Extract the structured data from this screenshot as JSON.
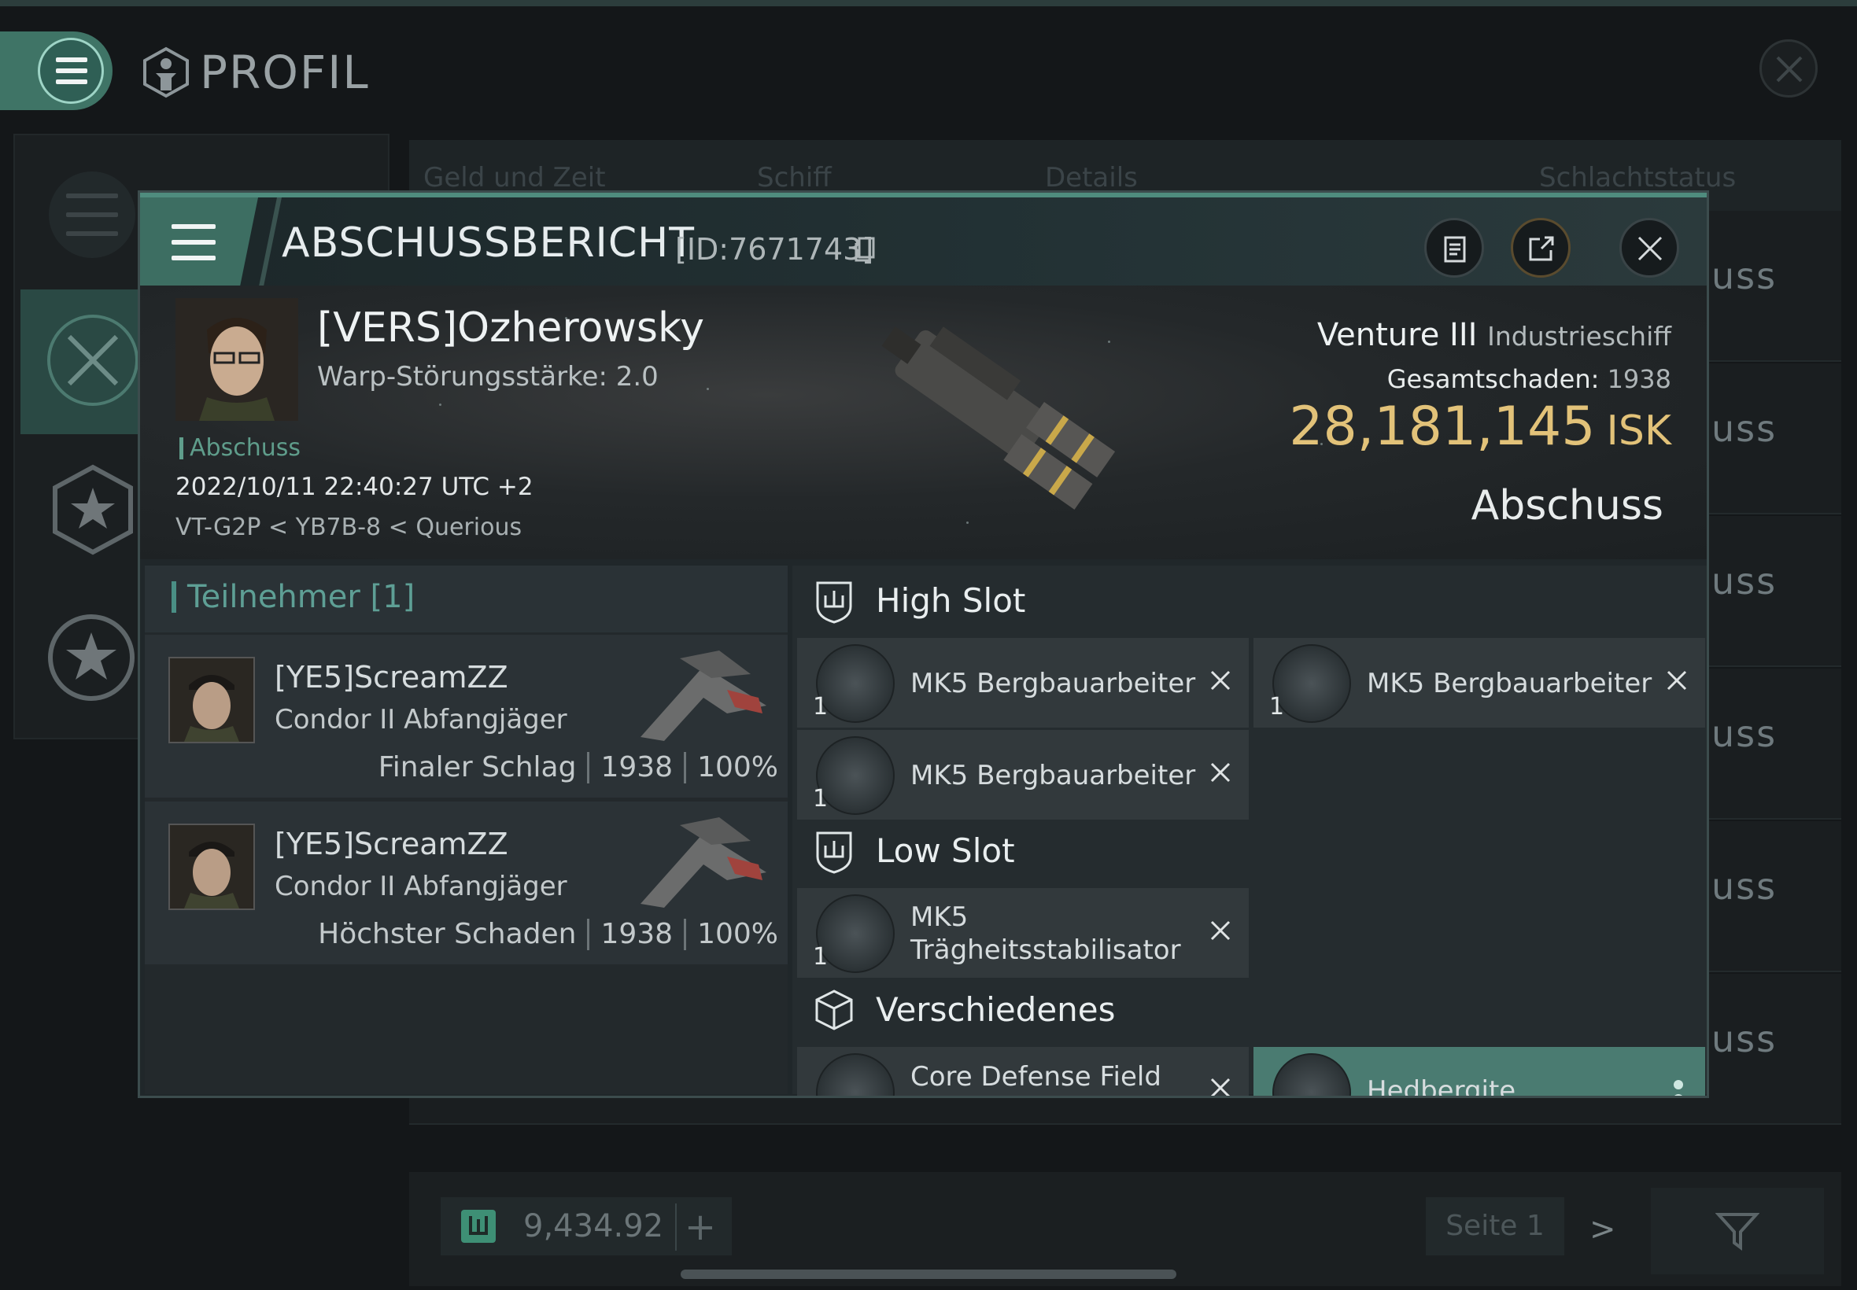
{
  "background": {
    "title": "PROFIL",
    "table_headers": [
      "Geld und Zeit",
      "Schiff",
      "Details",
      "Schlachtstatus"
    ],
    "rows": [
      "uss",
      "uss",
      "uss",
      "uss",
      "uss",
      "uss"
    ],
    "wallet": "9,434.92",
    "plus_label": "+",
    "page_label": "Seite 1",
    "next_label": ">"
  },
  "modal": {
    "title": "ABSCHUSSBERICHT",
    "id_label": "[ID:7671743]",
    "victim": {
      "name": "[VERS]Ozherowsky",
      "warp_strength": "Warp-Störungsstärke: 2.0",
      "tag": "Abschuss",
      "datetime": "2022/10/11 22:40:27 UTC +2",
      "location": "VT-G2P < YB7B-8 < Querious"
    },
    "ship": {
      "name": "Venture III",
      "class": "Industrieschiff",
      "damage_label": "Gesamtschaden:",
      "damage_value": "1938",
      "isk_value": "28,181,145",
      "isk_unit": "ISK",
      "result": "Abschuss"
    },
    "participants": {
      "header": "Teilnehmer [1]",
      "rows": [
        {
          "name": "[YE5]ScreamZZ",
          "ship": "Condor II Abfangjäger",
          "role": "Finaler Schlag",
          "damage": "1938",
          "percent": "100%"
        },
        {
          "name": "[YE5]ScreamZZ",
          "ship": "Condor II Abfangjäger",
          "role": "Höchster Schaden",
          "damage": "1938",
          "percent": "100%"
        }
      ]
    },
    "fitting": {
      "high_slot": "High Slot",
      "low_slot": "Low Slot",
      "misc": "Verschiedenes",
      "high_modules": [
        {
          "name": "MK5 Bergbauarbeiter",
          "qty": "1"
        },
        {
          "name": "MK5 Bergbauarbeiter",
          "qty": "1"
        },
        {
          "name": "MK5 Bergbauarbeiter",
          "qty": "1"
        }
      ],
      "low_modules": [
        {
          "name_line1": "MK5",
          "name_line2": "Trägheitsstabilisator",
          "qty": "1"
        }
      ],
      "misc_modules": [
        {
          "name": "Core Defense Field"
        },
        {
          "name": "Hedbergite"
        }
      ]
    }
  },
  "colors": {
    "accent": "#4f8c7e",
    "isk": "#e2c279",
    "tag": "#5f9d8b"
  }
}
